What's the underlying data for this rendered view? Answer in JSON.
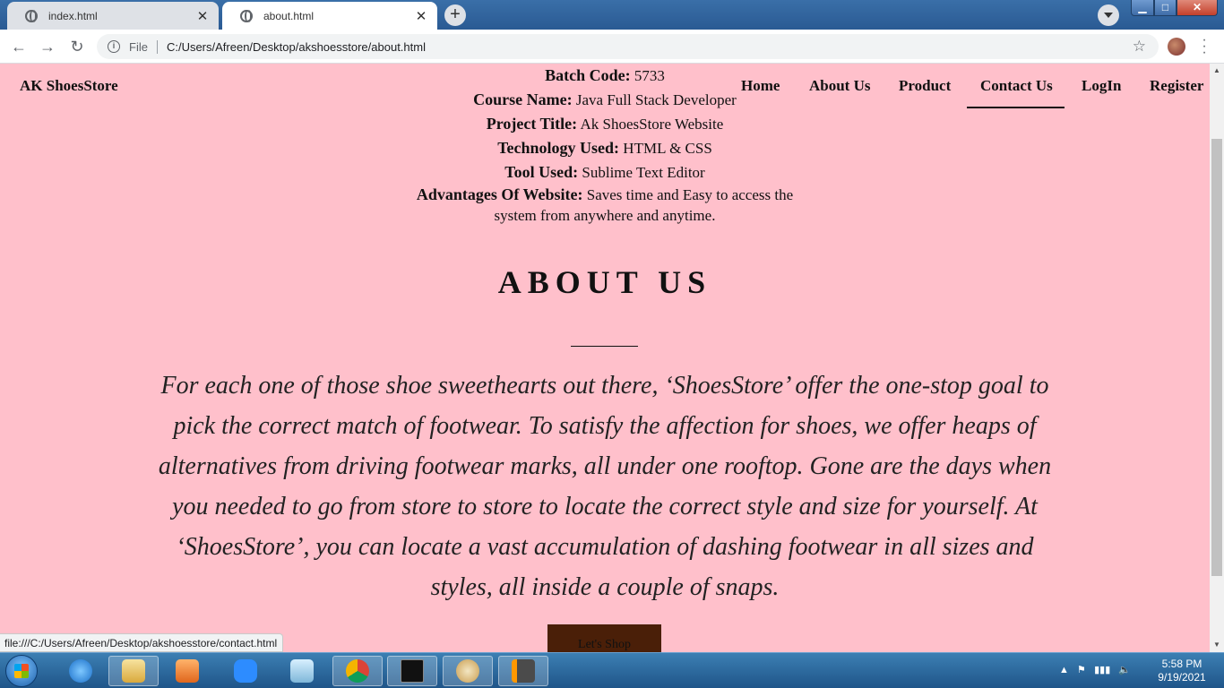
{
  "browser": {
    "tabs": [
      {
        "title": "index.html",
        "active": false
      },
      {
        "title": "about.html",
        "active": true
      }
    ],
    "file_label": "File",
    "url": "C:/Users/Afreen/Desktop/akshoesstore/about.html",
    "status_url": "file:///C:/Users/Afreen/Desktop/akshoesstore/contact.html"
  },
  "site": {
    "brand": "AK ShoesStore",
    "nav": [
      "Home",
      "About Us",
      "Product",
      "Contact Us",
      "LogIn",
      "Register"
    ],
    "active_nav": "Contact Us"
  },
  "project_info": {
    "batch_code_label": "Batch Code:",
    "batch_code": "5733",
    "course_name_label": "Course Name:",
    "course_name": "Java Full Stack Developer",
    "project_title_label": "Project Title:",
    "project_title": "Ak ShoesStore Website",
    "technology_label": "Technology Used:",
    "technology": "HTML & CSS",
    "tool_label": "Tool Used:",
    "tool": "Sublime Text Editor",
    "advantages_label": "Advantages Of Website:",
    "advantages": "Saves time and Easy to access the system from anywhere and anytime."
  },
  "about": {
    "title": "ABOUT US",
    "text": "For each one of those shoe sweethearts out there, ‘ShoesStore’ offer the one-stop goal to pick the correct match of footwear. To satisfy the affection for shoes, we offer heaps of alternatives from driving footwear marks, all under one rooftop. Gone are the days when you needed to go from store to store to locate the correct style and size for yourself. At ‘ShoesStore’, you can locate a vast accumulation of dashing footwear in all sizes and styles, all inside a couple of snaps.",
    "button": "Let's Shop"
  },
  "taskbar": {
    "time": "5:58 PM",
    "date": "9/19/2021",
    "apps": [
      "internet-explorer",
      "file-explorer",
      "media-player",
      "zoom",
      "notepad",
      "chrome",
      "command-prompt",
      "paint",
      "sublime-text"
    ]
  },
  "colors": {
    "page_background": "#ffc0cb",
    "button_background": "#4a1f08"
  }
}
